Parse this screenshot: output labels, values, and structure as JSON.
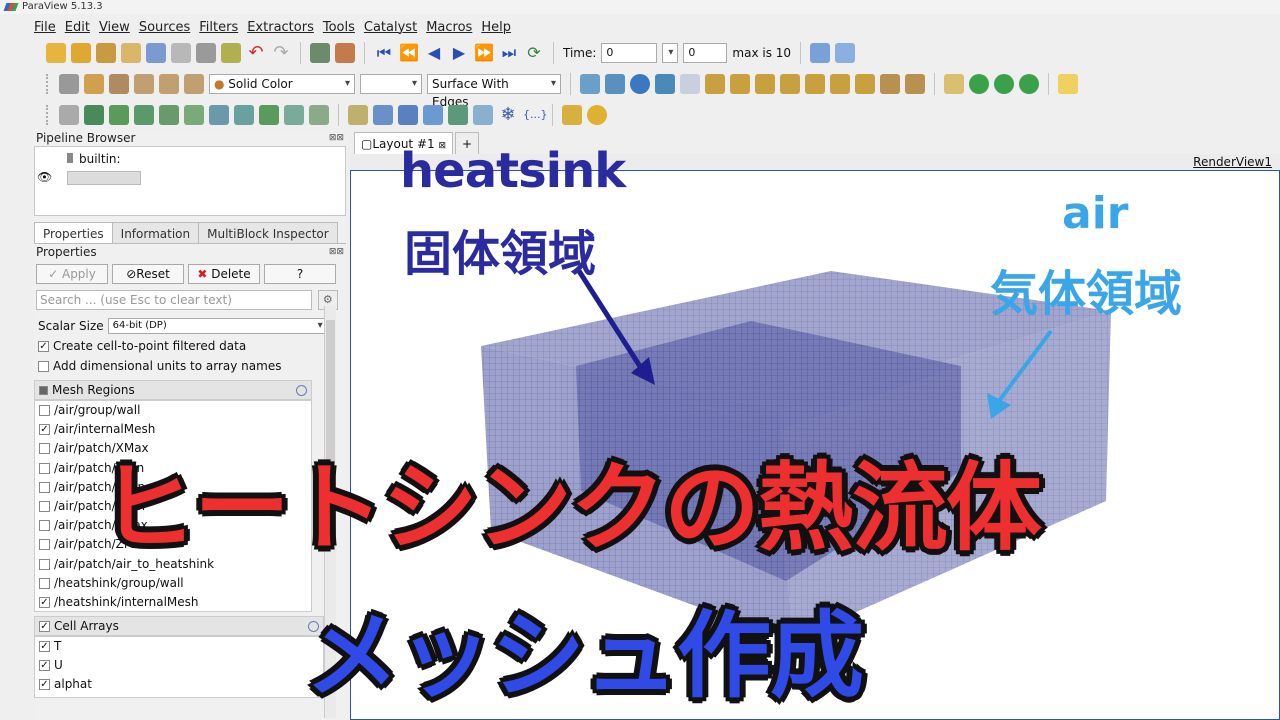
{
  "app": {
    "title": "ParaView 5.13.3"
  },
  "menu": [
    "File",
    "Edit",
    "View",
    "Sources",
    "Filters",
    "Extractors",
    "Tools",
    "Catalyst",
    "Macros",
    "Help"
  ],
  "toolbar": {
    "time_label": "Time:",
    "time_value": "0",
    "timestep_value": "0",
    "max_label": "max is 10",
    "coloring": "Solid Color",
    "representation": "Surface With Edges"
  },
  "pipeline": {
    "title": "Pipeline Browser",
    "root": "builtin:"
  },
  "tabs": [
    "Properties",
    "Information",
    "MultiBlock Inspector"
  ],
  "properties": {
    "title": "Properties",
    "apply": "Apply",
    "reset": "Reset",
    "delete": "Delete",
    "help": "?",
    "search_placeholder": "Search ... (use Esc to clear text)",
    "scalar_size_label": "Scalar Size",
    "scalar_size_value": "64-bit (DP)",
    "options": [
      {
        "label": "Create cell-to-point filtered data",
        "checked": true
      },
      {
        "label": "Add dimensional units to array names",
        "checked": false
      }
    ],
    "mesh_regions_title": "Mesh Regions",
    "mesh_regions": [
      {
        "label": "/air/group/wall",
        "checked": false
      },
      {
        "label": "/air/internalMesh",
        "checked": true
      },
      {
        "label": "/air/patch/XMax",
        "checked": false
      },
      {
        "label": "/air/patch/YMin",
        "checked": false
      },
      {
        "label": "/air/patch/XMin",
        "checked": false
      },
      {
        "label": "/air/patch/ZMin",
        "checked": false
      },
      {
        "label": "/air/patch/YMax",
        "checked": false
      },
      {
        "label": "/air/patch/ZMin",
        "checked": false
      },
      {
        "label": "/air/patch/air_to_heatshink",
        "checked": false
      },
      {
        "label": "/heatshink/group/wall",
        "checked": false
      },
      {
        "label": "/heatshink/internalMesh",
        "checked": true
      }
    ],
    "cell_arrays_title": "Cell Arrays",
    "cell_arrays": [
      {
        "label": "T",
        "checked": true
      },
      {
        "label": "U",
        "checked": true
      },
      {
        "label": "alphat",
        "checked": true
      }
    ]
  },
  "layout": {
    "tab": "Layout #1",
    "plus": "+",
    "view_name": "RenderView1"
  },
  "overlay": {
    "heatsink": "heatsink",
    "solid_region": "固体領域",
    "air": "air",
    "gas_region": "気体領域",
    "title_line1": "ヒートシンクの熱流体",
    "title_line2": "メッシュ作成"
  },
  "colors": {
    "title_red": "#ee2f2f",
    "title_blue": "#2f4ae6",
    "heatsink_label": "#2b2ba0",
    "air_label": "#3aa6e8",
    "mesh_fill": "#8c90c4"
  }
}
